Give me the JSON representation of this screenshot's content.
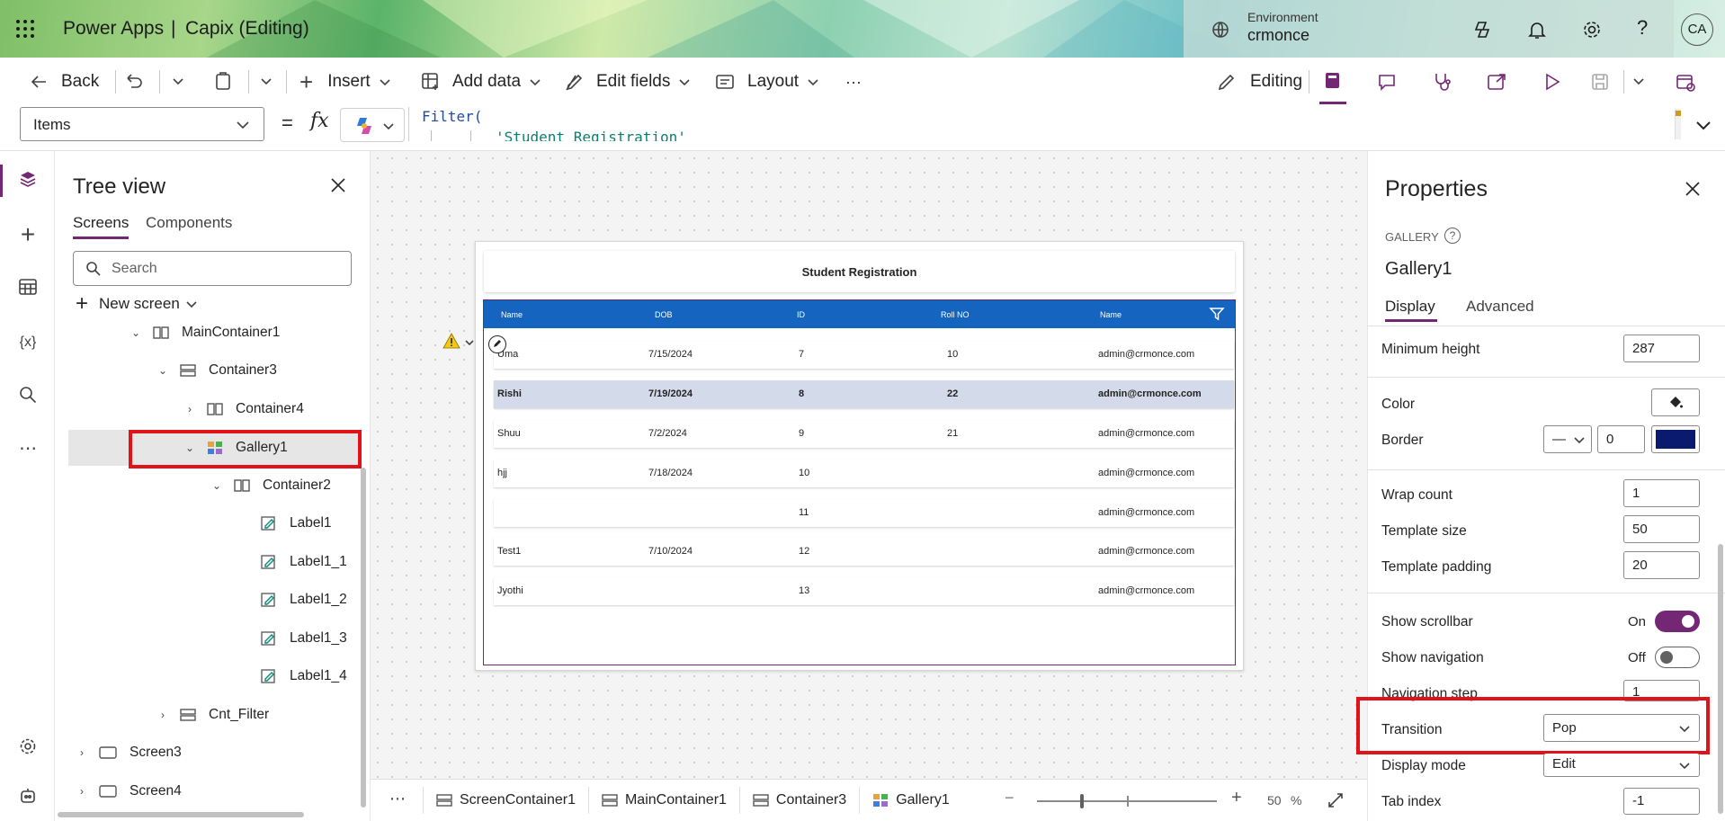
{
  "topbar": {
    "app_name": "Power Apps",
    "separator": "|",
    "app_title": "Capix (Editing)",
    "env_label": "Environment",
    "env_name": "crmonce",
    "avatar_initials": "CA"
  },
  "commandbar": {
    "back": "Back",
    "insert": "Insert",
    "add_data": "Add data",
    "edit_fields": "Edit fields",
    "layout": "Layout",
    "more": "···",
    "editing": "Editing"
  },
  "formula": {
    "property": "Items",
    "equals": "=",
    "fx": "fx",
    "line1": "Filter(",
    "line2": "'Student Registration'"
  },
  "tree": {
    "title": "Tree view",
    "tabs": [
      "Screens",
      "Components"
    ],
    "search_placeholder": "Search",
    "new_screen": "New screen",
    "nodes": [
      "MainContainer1",
      "Container3",
      "Container4",
      "Gallery1",
      "Container2",
      "Label1",
      "Label1_1",
      "Label1_2",
      "Label1_3",
      "Label1_4",
      "Cnt_Filter",
      "Screen3",
      "Screen4"
    ]
  },
  "app": {
    "title": "Student Registration",
    "columns": [
      "Name",
      "DOB",
      "ID",
      "Roll NO",
      "Name"
    ],
    "rows": [
      [
        "Uma",
        "7/15/2024",
        "7",
        "10",
        "admin@crmonce.com"
      ],
      [
        "Rishi",
        "7/19/2024",
        "8",
        "22",
        "admin@crmonce.com"
      ],
      [
        "Shuu",
        "7/2/2024",
        "9",
        "21",
        "admin@crmonce.com"
      ],
      [
        "hjj",
        "7/18/2024",
        "10",
        "",
        "admin@crmonce.com"
      ],
      [
        "",
        "",
        "11",
        "",
        "admin@crmonce.com"
      ],
      [
        "Test1",
        "7/10/2024",
        "12",
        "",
        "admin@crmonce.com"
      ],
      [
        "Jyothi",
        "",
        "13",
        "",
        "admin@crmonce.com"
      ]
    ]
  },
  "footer": {
    "crumbs": [
      "ScreenContainer1",
      "MainContainer1",
      "Container3",
      "Gallery1"
    ],
    "zoom": "50",
    "zoom_unit": "%",
    "zoom_minus": "−",
    "zoom_plus": "+"
  },
  "properties": {
    "title": "Properties",
    "kind": "GALLERY",
    "name": "Gallery1",
    "tabs": [
      "Display",
      "Advanced"
    ],
    "min_height_label": "Minimum height",
    "min_height": "287",
    "color_label": "Color",
    "border_label": "Border",
    "border_width": "0",
    "border_style": "—",
    "border_color": "#0a1a6e",
    "wrap_label": "Wrap count",
    "wrap": "1",
    "template_size_label": "Template size",
    "template_size": "50",
    "template_padding_label": "Template padding",
    "template_padding": "20",
    "scrollbar_label": "Show scrollbar",
    "scrollbar_value": "On",
    "navigation_label": "Show navigation",
    "navigation_value": "Off",
    "nav_step_label": "Navigation step",
    "nav_step": "1",
    "transition_label": "Transition",
    "transition": "Pop",
    "display_mode_label": "Display mode",
    "display_mode": "Edit",
    "tab_index_label": "Tab index",
    "tab_index": "-1"
  },
  "colors": {
    "accent": "#742774",
    "gallery_header": "#1565c0",
    "highlight": "#e0121a",
    "selected_row": "#d3dbea"
  }
}
